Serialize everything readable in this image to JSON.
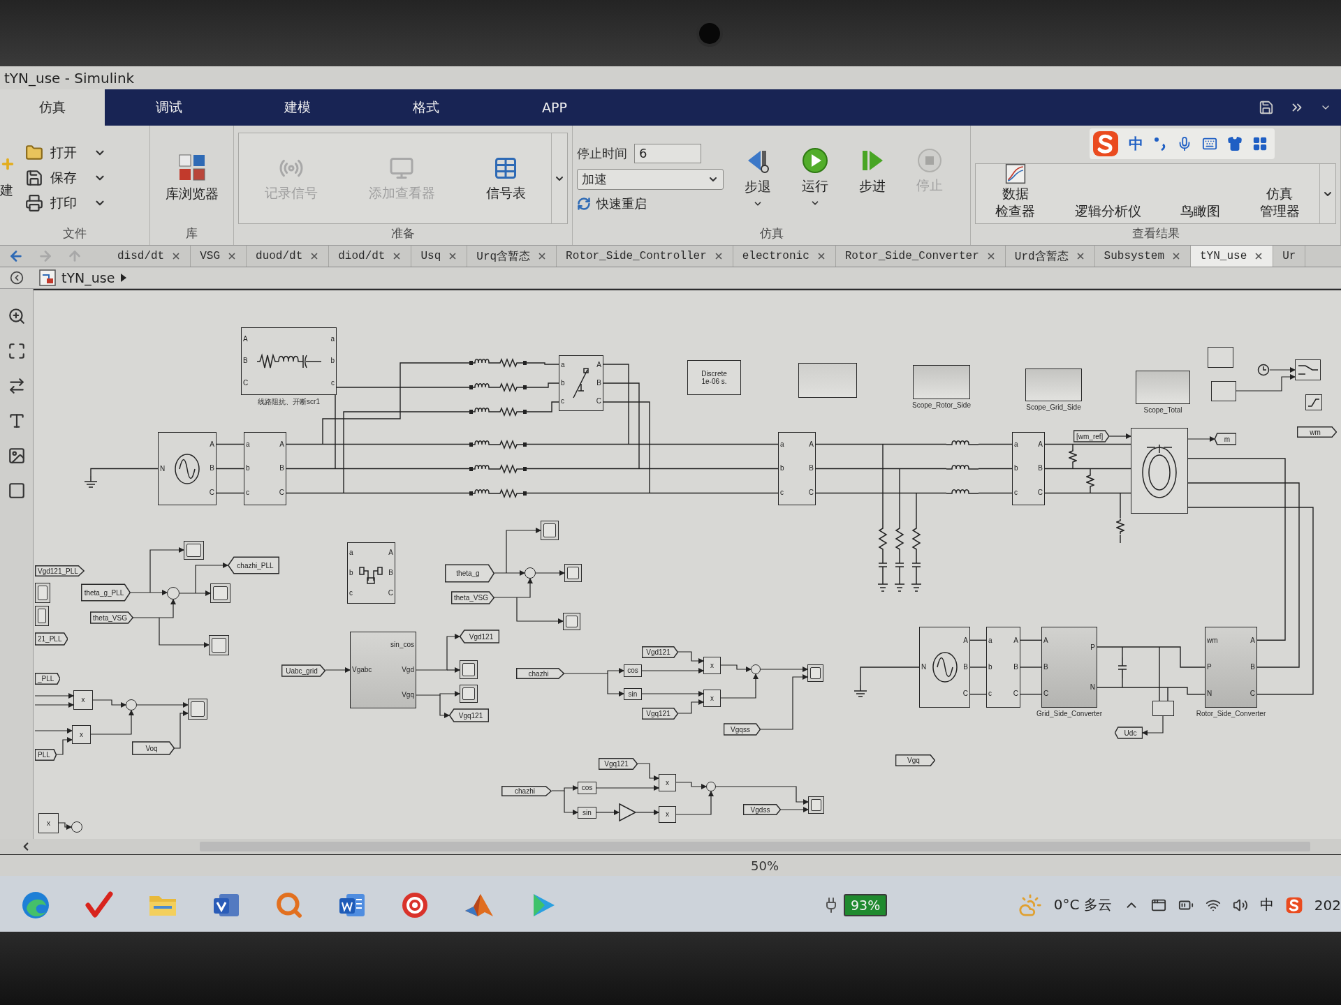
{
  "window": {
    "title": "tYN_use - Simulink"
  },
  "ribbon_tabs": [
    {
      "label": "仿真",
      "selected": true
    },
    {
      "label": "调试",
      "selected": false
    },
    {
      "label": "建模",
      "selected": false
    },
    {
      "label": "格式",
      "selected": false
    },
    {
      "label": "APP",
      "selected": false
    }
  ],
  "ribbon": {
    "file": {
      "section": "文件",
      "new_label": "建",
      "items": [
        {
          "label": "打开"
        },
        {
          "label": "保存"
        },
        {
          "label": "打印"
        }
      ]
    },
    "library": {
      "section": "库",
      "button": "库浏览器"
    },
    "prepare": {
      "section": "准备",
      "items": [
        {
          "label": "记录信号",
          "disabled": true
        },
        {
          "label": "添加查看器",
          "disabled": true
        },
        {
          "label": "信号表",
          "disabled": false
        }
      ]
    },
    "simulate": {
      "section": "仿真",
      "stop_time_label": "停止时间",
      "stop_time": "6",
      "mode": "加速",
      "fast_restart": "快速重启",
      "buttons": [
        {
          "label": "步退",
          "disabled": false,
          "menu": true
        },
        {
          "label": "运行",
          "disabled": false,
          "menu": true
        },
        {
          "label": "步进",
          "disabled": false,
          "menu": false
        },
        {
          "label": "停止",
          "disabled": true,
          "menu": false
        }
      ]
    },
    "results": {
      "section": "查看结果",
      "items": [
        {
          "lines": [
            "数据",
            "检查器"
          ]
        },
        {
          "lines": [
            "逻辑分析仪"
          ]
        },
        {
          "lines": [
            "鸟瞰图"
          ]
        },
        {
          "lines": [
            "仿真",
            "管理器"
          ]
        }
      ]
    }
  },
  "ime_toolbar": {
    "mode": "中"
  },
  "model_tabs": [
    {
      "label": "disd/dt",
      "selected": false,
      "closable": true
    },
    {
      "label": "VSG",
      "selected": false,
      "closable": true
    },
    {
      "label": "duod/dt",
      "selected": false,
      "closable": true
    },
    {
      "label": "diod/dt",
      "selected": false,
      "closable": true
    },
    {
      "label": "Usq",
      "selected": false,
      "closable": true
    },
    {
      "label": "Urq含暂态",
      "selected": false,
      "closable": true
    },
    {
      "label": "Rotor_Side_Controller",
      "selected": false,
      "closable": true
    },
    {
      "label": "electronic",
      "selected": false,
      "closable": true
    },
    {
      "label": "Rotor_Side_Converter",
      "selected": false,
      "closable": true
    },
    {
      "label": "Urd含暂态",
      "selected": false,
      "closable": true
    },
    {
      "label": "Subsystem",
      "selected": false,
      "closable": true
    },
    {
      "label": "tYN_use",
      "selected": true,
      "closable": true
    },
    {
      "label": "Ur",
      "selected": false,
      "closable": false
    }
  ],
  "breadcrumb": {
    "path": "tYN_use"
  },
  "diagram": {
    "line_section": [
      {
        "kind": "rlc_branch",
        "in_ports": [
          "A",
          "B",
          "C"
        ],
        "out_ports": [
          "a",
          "b",
          "c"
        ],
        "caption": "线路阻抗、开断scr1"
      },
      {
        "kind": "breaker",
        "in_ports": [
          "a",
          "b",
          "c"
        ],
        "out_ports": [
          "A",
          "B",
          "C"
        ]
      },
      {
        "kind": "three_phase_source",
        "in_ports": [
          "N"
        ],
        "out_ports": [
          "A",
          "B",
          "C"
        ]
      },
      {
        "kind": "vi_measurement",
        "in_ports": [
          "a",
          "b",
          "c"
        ],
        "out_ports": [
          "A",
          "B",
          "C"
        ]
      }
    ],
    "scope_row": [
      {
        "kind": "powergui",
        "lines": [
          "Discrete",
          "1e-06 s."
        ]
      },
      {
        "kind": "scope_big",
        "caption": "Scope_Rotor_Side"
      },
      {
        "kind": "scope_big",
        "caption": "Scope_Grid_Side"
      },
      {
        "kind": "scope_big",
        "caption": "Scope_Total"
      }
    ],
    "generator_section": [
      {
        "kind": "vi_measurement",
        "in_ports": [
          "a",
          "b",
          "c"
        ],
        "out_ports": [
          "A",
          "B",
          "C"
        ]
      },
      {
        "kind": "vi_measurement",
        "in_ports": [
          "a",
          "b",
          "c"
        ],
        "out_ports": [
          "A",
          "B",
          "C"
        ]
      },
      {
        "kind": "from",
        "label": "[wm_ref]"
      },
      {
        "kind": "goto",
        "label": "m"
      },
      {
        "kind": "from",
        "label": "wm"
      }
    ],
    "pll_signals": [
      {
        "kind": "from",
        "label": "Vgd121_PLL"
      },
      {
        "kind": "goto",
        "label": "chazhi_PLL"
      },
      {
        "kind": "from",
        "label": "theta_g_PLL"
      },
      {
        "kind": "from",
        "label": "theta_VSG"
      },
      {
        "kind": "from",
        "label": "21_PLL"
      },
      {
        "kind": "from",
        "label": "_PLL"
      },
      {
        "kind": "product",
        "label": "x"
      },
      {
        "kind": "product",
        "label": "x"
      },
      {
        "kind": "from",
        "label": "PLL"
      },
      {
        "kind": "from",
        "label": "Voq"
      },
      {
        "kind": "product",
        "label": "x"
      }
    ],
    "pll_block_section": [
      {
        "kind": "three_phase_block",
        "in_ports": [
          "a",
          "b",
          "c"
        ],
        "out_ports": [
          "A",
          "B",
          "C"
        ]
      },
      {
        "kind": "from",
        "label": "theta_g"
      },
      {
        "kind": "from",
        "label": "theta_VSG"
      },
      {
        "kind": "subsystem",
        "in_ports": [
          "Vgabc"
        ],
        "out_ports": [
          "sin_cos",
          "Vgd",
          "Vgq"
        ]
      },
      {
        "kind": "goto",
        "label": "Vgd121"
      },
      {
        "kind": "from",
        "label": "Uabc_grid"
      },
      {
        "kind": "from",
        "label": "chazhi"
      },
      {
        "kind": "goto",
        "label": "Vgq121"
      },
      {
        "kind": "from",
        "label": "chazhi"
      }
    ],
    "dq_section": [
      {
        "kind": "from",
        "label": "Vgd121"
      },
      {
        "kind": "trig",
        "label": "cos"
      },
      {
        "kind": "product",
        "label": "x"
      },
      {
        "kind": "trig",
        "label": "sin"
      },
      {
        "kind": "product",
        "label": "x"
      },
      {
        "kind": "from",
        "label": "Vgq121"
      },
      {
        "kind": "from",
        "label": "Vgqss"
      },
      {
        "kind": "from",
        "label": "Vgq121"
      },
      {
        "kind": "from",
        "label": "Vgq"
      },
      {
        "kind": "trig",
        "label": "cos"
      },
      {
        "kind": "product",
        "label": "x"
      },
      {
        "kind": "trig",
        "label": "sin"
      },
      {
        "kind": "product",
        "label": "x"
      },
      {
        "kind": "from",
        "label": "Vgdss"
      }
    ],
    "converter_section": [
      {
        "kind": "three_phase_source",
        "in_ports": [
          "N"
        ],
        "out_ports": [
          "A",
          "B",
          "C"
        ]
      },
      {
        "kind": "vi_measurement",
        "in_ports": [
          "a",
          "b",
          "c"
        ],
        "out_ports": [
          "A",
          "B",
          "C"
        ]
      },
      {
        "kind": "converter",
        "in_ports": [
          "A",
          "B",
          "C"
        ],
        "out_ports": [
          "P",
          "N"
        ],
        "caption": "Grid_Side_Converter"
      },
      {
        "kind": "converter",
        "in_ports": [
          "wm",
          "P",
          "N"
        ],
        "out_ports": [
          "A",
          "B",
          "C"
        ],
        "caption": "Rotor_Side_Converter"
      },
      {
        "kind": "goto",
        "label": "Udc"
      }
    ],
    "rl_branches": [
      {
        "kind": "rl_branch"
      },
      {
        "kind": "rl_branch"
      },
      {
        "kind": "rl_branch"
      },
      {
        "kind": "rl_branch"
      },
      {
        "kind": "rl_branch"
      },
      {
        "kind": "rl_branch"
      }
    ],
    "top_blocks": [
      {
        "kind": "empty"
      },
      {
        "kind": "constant"
      },
      {
        "kind": "clock"
      },
      {
        "kind": "switch"
      },
      {
        "kind": "constant"
      },
      {
        "kind": "saturation"
      }
    ],
    "scopes": [
      {
        "kind": "scope"
      },
      {
        "kind": "scope"
      },
      {
        "kind": "scope"
      },
      {
        "kind": "scope"
      },
      {
        "kind": "scope"
      },
      {
        "kind": "scope"
      },
      {
        "kind": "scope"
      },
      {
        "kind": "scope"
      },
      {
        "kind": "scope"
      },
      {
        "kind": "scope"
      },
      {
        "kind": "scope"
      },
      {
        "kind": "scope"
      },
      {
        "kind": "scope"
      }
    ],
    "resistors": [
      {
        "kind": "resistor"
      },
      {
        "kind": "resistor"
      },
      {
        "kind": "resistor"
      }
    ],
    "sums": [
      {
        "kind": "sum"
      },
      {
        "kind": "sum"
      },
      {
        "kind": "sum"
      },
      {
        "kind": "sum"
      },
      {
        "kind": "sum"
      },
      {
        "kind": "sum"
      }
    ],
    "grounds": [
      {
        "kind": "ground"
      },
      {
        "kind": "ground"
      }
    ],
    "inductors": [
      {
        "kind": "inductor"
      },
      {
        "kind": "inductor"
      },
      {
        "kind": "inductor"
      }
    ],
    "rc_branches": [
      {
        "kind": "rc_ground"
      },
      {
        "kind": "rc_ground"
      },
      {
        "kind": "rc_ground"
      }
    ],
    "machine_side_blocks": [
      {
        "kind": "machine"
      },
      {
        "kind": "capacitor"
      },
      {
        "kind": "subtract"
      },
      {
        "kind": "gain"
      }
    ]
  },
  "status_bar": {
    "zoom": "50%"
  },
  "taskbar": {
    "battery": "93%",
    "weather": "0°C 多云",
    "ime": "中",
    "clock": "202"
  }
}
